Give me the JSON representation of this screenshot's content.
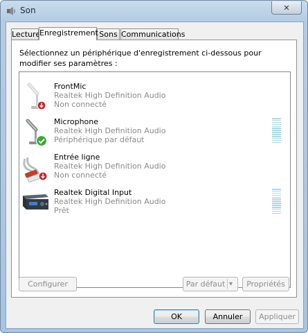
{
  "window": {
    "title": "Son",
    "close_glyph": "✕"
  },
  "tabs": [
    {
      "label": "Lecture",
      "active": false
    },
    {
      "label": "Enregistrement",
      "active": true
    },
    {
      "label": "Sons",
      "active": false
    },
    {
      "label": "Communications",
      "active": false
    }
  ],
  "panel": {
    "instruction": "Sélectionnez un périphérique d'enregistrement ci-dessous pour modifier ses paramètres :"
  },
  "devices": [
    {
      "name": "FrontMic",
      "driver": "Realtek High Definition Audio",
      "status": "Non connecté",
      "icon": "microphone-icon",
      "badge": "disconnected-badge-icon",
      "level_meter": false
    },
    {
      "name": "Microphone",
      "driver": "Realtek High Definition Audio",
      "status": "Périphérique par défaut",
      "icon": "microphone-icon",
      "badge": "default-checkmark-badge-icon",
      "level_meter": true,
      "level": 0
    },
    {
      "name": "Entrée ligne",
      "driver": "Realtek High Definition Audio",
      "status": "Non connecté",
      "icon": "line-in-cable-icon",
      "badge": "disconnected-badge-icon",
      "level_meter": false
    },
    {
      "name": "Realtek Digital Input",
      "driver": "Realtek High Definition Audio",
      "status": "Prêt",
      "icon": "digital-input-device-icon",
      "badge": "",
      "level_meter": true,
      "level": 0
    }
  ],
  "buttons": {
    "configure": "Configurer",
    "set_default": "Par défaut",
    "set_default_arrow": "▾",
    "properties": "Propriétés",
    "ok": "OK",
    "cancel": "Annuler",
    "apply": "Appliquer"
  },
  "colors": {
    "accent_checkmark": "#3aa935",
    "badge_red": "#c8262a",
    "meter": "#a9d9e6"
  }
}
